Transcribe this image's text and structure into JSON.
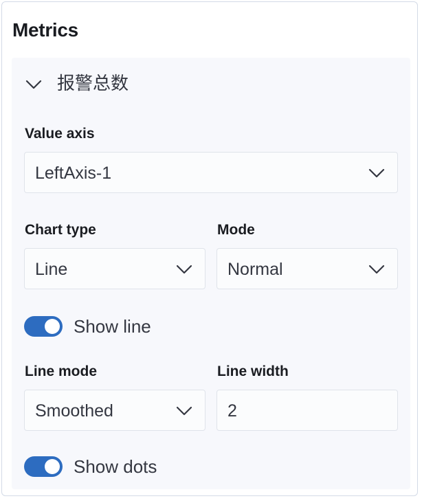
{
  "panel": {
    "title": "Metrics"
  },
  "metric": {
    "name": "报警总数",
    "expanded": true,
    "value_axis": {
      "label": "Value axis",
      "value": "LeftAxis-1"
    },
    "chart_type": {
      "label": "Chart type",
      "value": "Line"
    },
    "mode": {
      "label": "Mode",
      "value": "Normal"
    },
    "show_line": {
      "label": "Show line",
      "checked": true
    },
    "line_mode": {
      "label": "Line mode",
      "value": "Smoothed"
    },
    "line_width": {
      "label": "Line width",
      "value": "2"
    },
    "show_dots": {
      "label": "Show dots",
      "checked": true
    }
  },
  "icons": {
    "collapse": "chevron-down-icon",
    "select_arrow": "chevron-down-icon"
  },
  "colors": {
    "accent": "#2d6cc0",
    "section_bg": "#f7f8fc",
    "field_bg": "#fbfcfd",
    "border": "#dfe3ea",
    "text": "#1a1c21"
  }
}
